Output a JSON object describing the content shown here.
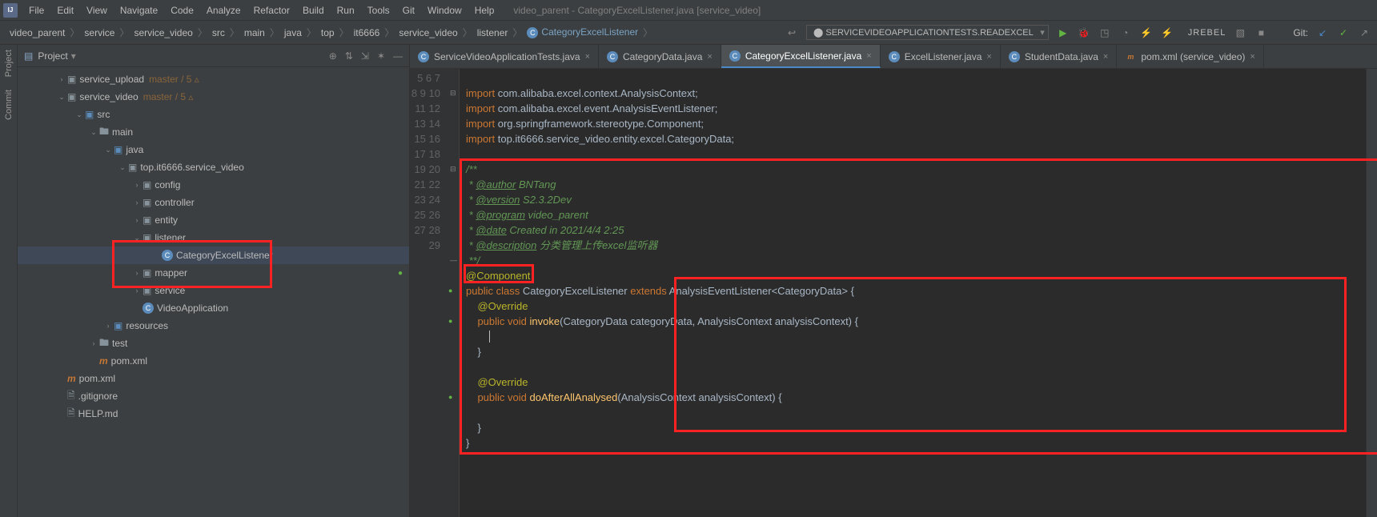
{
  "title": "video_parent - CategoryExcelListener.java [service_video]",
  "menu": [
    "File",
    "Edit",
    "View",
    "Navigate",
    "Code",
    "Analyze",
    "Refactor",
    "Build",
    "Run",
    "Tools",
    "Git",
    "Window",
    "Help"
  ],
  "breadcrumb": [
    "video_parent",
    "service",
    "service_video",
    "src",
    "main",
    "java",
    "top",
    "it6666",
    "service_video",
    "listener",
    "CategoryExcelListener"
  ],
  "run_config": "SERVICEVIDEOAPPLICATIONTESTS.READEXCEL",
  "jrebel": "JREBEL",
  "git_label": "Git:",
  "project_label": "Project",
  "tree": {
    "n0": {
      "label": "service_upload",
      "vcs": "master / 5 ▵",
      "indent": 48,
      "arrow": "›",
      "ico": "mod"
    },
    "n1": {
      "label": "service_video",
      "vcs": "master / 5 ▵",
      "indent": 48,
      "arrow": "⌄",
      "ico": "mod"
    },
    "n2": {
      "label": "src",
      "indent": 70,
      "arrow": "⌄",
      "ico": "src"
    },
    "n3": {
      "label": "main",
      "indent": 88,
      "arrow": "⌄",
      "ico": "dir"
    },
    "n4": {
      "label": "java",
      "indent": 106,
      "arrow": "⌄",
      "ico": "src"
    },
    "n5": {
      "label": "top.it6666.service_video",
      "indent": 124,
      "arrow": "⌄",
      "ico": "pkg"
    },
    "n6": {
      "label": "config",
      "indent": 142,
      "arrow": "›",
      "ico": "pkg"
    },
    "n7": {
      "label": "controller",
      "indent": 142,
      "arrow": "›",
      "ico": "pkg"
    },
    "n8": {
      "label": "entity",
      "indent": 142,
      "arrow": "›",
      "ico": "pkg"
    },
    "n9": {
      "label": "listener",
      "indent": 142,
      "arrow": "⌄",
      "ico": "pkg"
    },
    "n10": {
      "label": "CategoryExcelListener",
      "indent": 166,
      "arrow": "",
      "ico": "cls",
      "selected": true
    },
    "n11": {
      "label": "mapper",
      "indent": 142,
      "arrow": "›",
      "ico": "pkg",
      "ind": "●"
    },
    "n12": {
      "label": "service",
      "indent": 142,
      "arrow": "›",
      "ico": "pkg"
    },
    "n13": {
      "label": "VideoApplication",
      "indent": 142,
      "arrow": "",
      "ico": "cls2"
    },
    "n14": {
      "label": "resources",
      "indent": 106,
      "arrow": "›",
      "ico": "res"
    },
    "n15": {
      "label": "test",
      "indent": 88,
      "arrow": "›",
      "ico": "dir"
    },
    "n16": {
      "label": "pom.xml",
      "indent": 88,
      "arrow": "",
      "ico": "xml"
    },
    "n17": {
      "label": "pom.xml",
      "indent": 48,
      "arrow": "",
      "ico": "xml"
    },
    "n18": {
      "label": ".gitignore",
      "indent": 48,
      "arrow": "",
      "ico": "file"
    },
    "n19": {
      "label": "HELP.md",
      "indent": 48,
      "arrow": "",
      "ico": "md"
    }
  },
  "tabs": [
    {
      "label": "ServiceVideoApplicationTests.java",
      "ico": "c"
    },
    {
      "label": "CategoryData.java",
      "ico": "c"
    },
    {
      "label": "CategoryExcelListener.java",
      "ico": "c",
      "active": true
    },
    {
      "label": "ExcelListener.java",
      "ico": "c"
    },
    {
      "label": "StudentData.java",
      "ico": "c"
    },
    {
      "label": "pom.xml (service_video)",
      "ico": "m"
    }
  ],
  "lines": {
    "start": 5,
    "end": 29
  },
  "code": {
    "author": "BNTang",
    "version": "S2.3.2Dev",
    "program": "video_parent",
    "date": "Created in 2021/4/4 2:25",
    "description": "分类管理上传excel监听器",
    "imports": [
      "com.alibaba.excel.context.AnalysisContext",
      "com.alibaba.excel.event.AnalysisEventListener",
      "org.springframework.stereotype.Component",
      "top.it6666.service_video.entity.excel.CategoryData"
    ],
    "annotation": "@Component",
    "classname": "CategoryExcelListener",
    "extends": "AnalysisEventListener",
    "generic": "CategoryData",
    "m1": "invoke",
    "m1p": "(CategoryData categoryData, AnalysisContext analysisContext)",
    "m2": "doAfterAllAnalysed",
    "m2p": "(AnalysisContext analysisContext)"
  }
}
